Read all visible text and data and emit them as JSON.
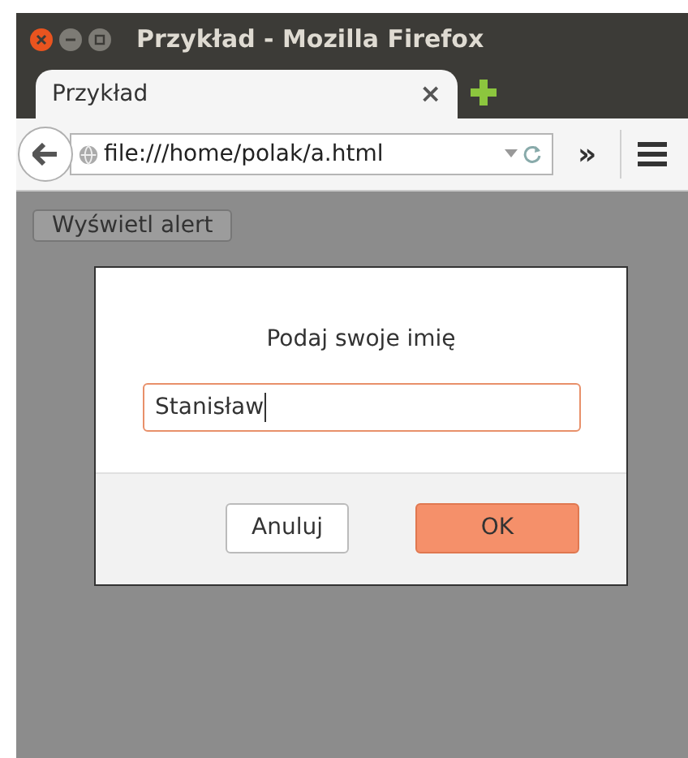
{
  "window": {
    "title": "Przykład - Mozilla Firefox"
  },
  "tabs": [
    {
      "label": "Przykład",
      "close": "×",
      "selected": true
    }
  ],
  "toolbar": {
    "url": "file:///home/polak/a.html",
    "overflow": "»"
  },
  "page": {
    "button": "Wyświetl alert"
  },
  "dialog": {
    "message": "Podaj swoje imię",
    "value": "Stanisław",
    "buttons": [
      {
        "label": "Anuluj",
        "kind": "cancel"
      },
      {
        "label": "OK",
        "kind": "default"
      }
    ]
  }
}
